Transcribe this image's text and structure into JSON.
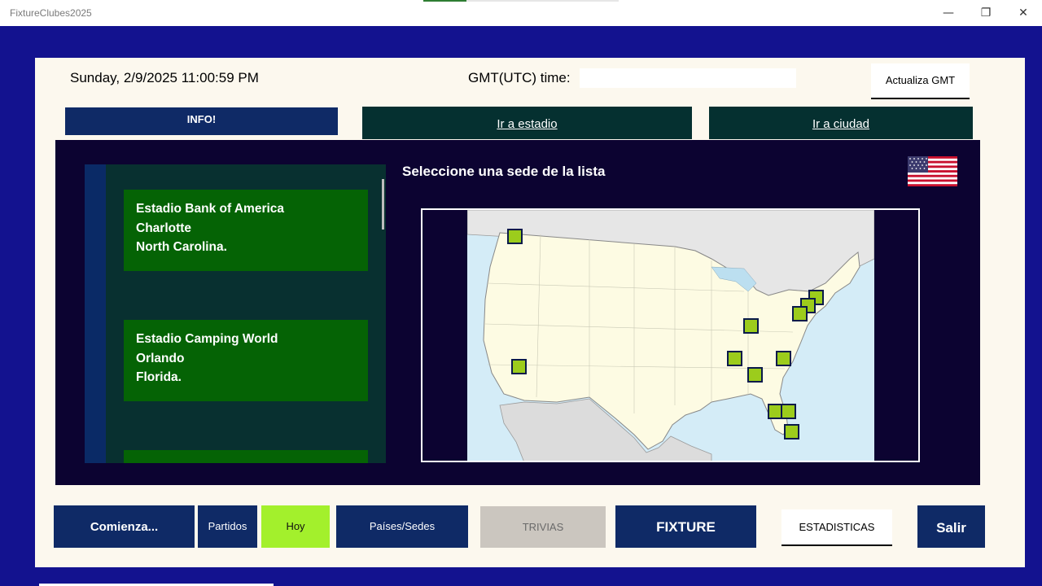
{
  "window": {
    "title": "FixtureClubes2025",
    "minimize": "—",
    "restore": "❐",
    "close": "✕",
    "loading_progress_pct": 22
  },
  "header": {
    "datetime": "Sunday, 2/9/2025 11:00:59 PM",
    "gmt_label": "GMT(UTC) time:",
    "gmt_value": "",
    "update_gmt_button": "Actualiza GMT"
  },
  "nav": {
    "info_button": "INFO!",
    "stadium_button": "Ir a estadio",
    "city_button": "Ir a ciudad"
  },
  "venues": [
    {
      "line1": "Estadio Bank of America",
      "line2": "Charlotte",
      "line3": "North Carolina."
    },
    {
      "line1": "Estadio Camping World",
      "line2": "Orlando",
      "line3": "Florida."
    },
    {
      "line1": "",
      "line2": "",
      "line3": ""
    }
  ],
  "map": {
    "prompt": "Seleccione una sede de la lista",
    "flag_icon": "usa-flag-icon",
    "marker_color": "#9ccc1c",
    "marker_count": 13
  },
  "footer": {
    "start_button": "Comienza...",
    "matches_button": "Partidos",
    "today_button": "Hoy",
    "countries_button": "Países/Sedes",
    "trivia_button": "TRIVIAS",
    "fixture_button": "FIXTURE",
    "stats_button": "ESTADISTICAS",
    "exit_button": "Salir"
  },
  "colors": {
    "outer_bg": "#13128f",
    "panel_bg": "#fcf8ee",
    "navy_button": "#0f2a66",
    "teal_button": "#053030",
    "venue_green": "#056305",
    "today_green": "#a3f02c",
    "dark_area": "#0c0331"
  }
}
